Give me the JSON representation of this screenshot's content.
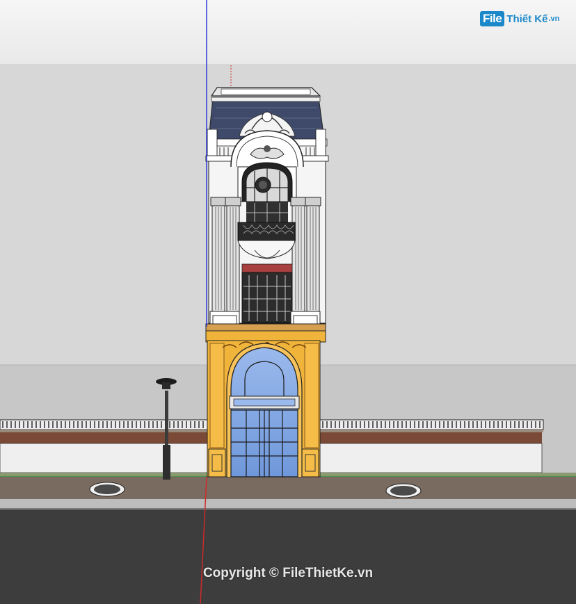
{
  "watermark": {
    "logo_file": "File",
    "logo_rest": "Thiết Kế",
    "logo_domain": ".vn",
    "copyright": "Copyright © FileThietKe.vn"
  },
  "scene": {
    "subject": "3-storey neoclassical townhouse facade model",
    "colors": {
      "sky_top": "#f3f3f3",
      "back_wall": "#d6d6d6",
      "road": "#3d3d3d",
      "sidewalk": "#7a6a5e",
      "ground_floor_facade": "#f0b43a",
      "glass": "#7fa7e3",
      "roof": "#3f4a6a",
      "axis_blue": "#2a3cd8",
      "axis_red": "#cc2a2a"
    }
  }
}
